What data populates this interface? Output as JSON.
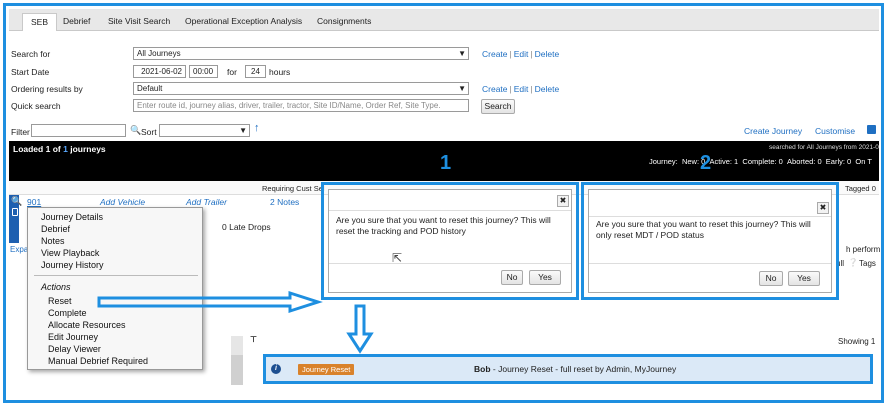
{
  "tabs": [
    {
      "label": "SEB",
      "active": true
    },
    {
      "label": "Debrief"
    },
    {
      "label": "Site Visit Search"
    },
    {
      "label": "Operational Exception Analysis"
    },
    {
      "label": "Consignments"
    }
  ],
  "form": {
    "search_for_label": "Search for",
    "search_for_value": "All Journeys",
    "start_date_label": "Start Date",
    "start_date_value": "2021-06-02",
    "start_time_value": "00:00",
    "for_label": "for",
    "hours_value": "24",
    "hours_label": "hours",
    "ordering_label": "Ordering results by",
    "ordering_value": "Default",
    "quick_search_label": "Quick search",
    "quick_search_placeholder": "Enter route id, journey alias, driver, trailer, tractor, Site ID/Name, Order Ref, Site Type.",
    "search_button": "Search",
    "create_link": "Create",
    "edit_link": "Edit",
    "delete_link": "Delete"
  },
  "filterbar": {
    "filter_label": "Filter",
    "sort_label": "Sort",
    "create_journey": "Create Journey",
    "customise": "Customise"
  },
  "summary": {
    "loaded_prefix": "Loaded",
    "loaded_count": "1",
    "loaded_of": "of",
    "loaded_total": "1",
    "loaded_suffix": "journeys",
    "searched_for": "searched for All Journeys from 2021-0",
    "journey_label": "Journey:",
    "new": "New: 0",
    "active": "Active: 1",
    "complete": "Complete: 0",
    "aborted": "Aborted: 0",
    "early": "Early: 0",
    "on_time": "On T"
  },
  "subheader": {
    "requiring": "Requiring Cust Sel",
    "tagged": "Tagged 0"
  },
  "row": {
    "journey_id": "901",
    "add_vehicle": "Add Vehicle",
    "add_trailer": "Add Trailer",
    "notes": "2 Notes",
    "late_drops": "0 Late Drops",
    "expand": "Expa",
    "perform": "h perform",
    "all_tags": "ull",
    "tags": "Tags",
    "showing": "Showing 1"
  },
  "context_menu": {
    "items_top": [
      "Journey Details",
      "Debrief",
      "Notes",
      "View Playback",
      "Journey History"
    ],
    "actions_header": "Actions",
    "items_actions": [
      "Reset",
      "Complete",
      "Allocate Resources",
      "Edit Journey",
      "Delay Viewer",
      "Manual Debrief Required"
    ]
  },
  "dialogs": [
    {
      "number": "1",
      "message": "Are you sure that you want to reset this journey? This will reset the tracking and POD history",
      "no": "No",
      "yes": "Yes"
    },
    {
      "number": "2",
      "message": "Are you sure that you want to reset this journey? This will only reset MDT / POD status",
      "no": "No",
      "yes": "Yes"
    }
  ],
  "reset_event": {
    "badge": "Journey Reset",
    "user": "Bob",
    "text": "- Journey Reset - full reset by Admin, MyJourney"
  },
  "colors": {
    "accent": "#1e8fe0",
    "badge": "#d9822b",
    "link": "#1f6fc2"
  }
}
